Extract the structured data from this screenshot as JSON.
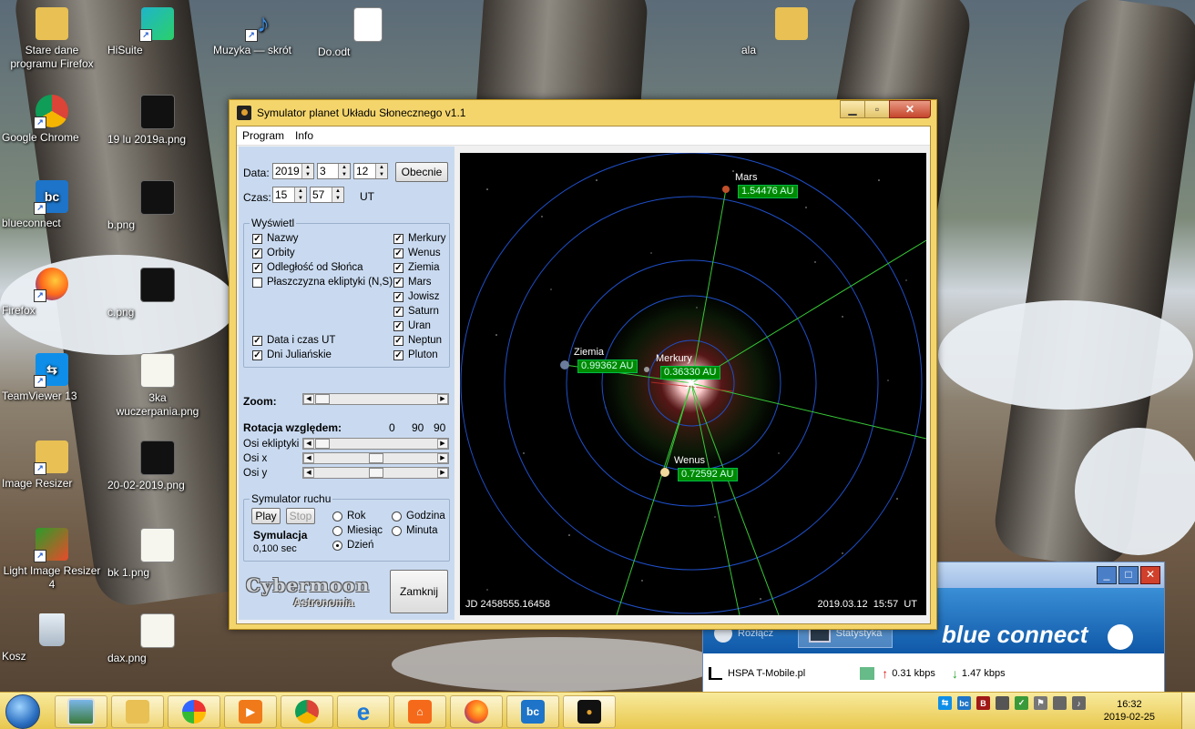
{
  "desktop": {
    "icons": [
      {
        "label": "Stare dane programu Firefox"
      },
      {
        "label": "HiSuite"
      },
      {
        "label": "Muzyka — skrót"
      },
      {
        "label": "Do.odt"
      },
      {
        "label": "ala"
      },
      {
        "label": "Google Chrome"
      },
      {
        "label": "19 lu 2019a.png"
      },
      {
        "label": "blueconnect"
      },
      {
        "label": "b.png"
      },
      {
        "label": "Firefox"
      },
      {
        "label": "c.png"
      },
      {
        "label": "TeamViewer 13"
      },
      {
        "label": "3ka wuczerpania.png"
      },
      {
        "label": "Image Resizer"
      },
      {
        "label": "20-02-2019.png"
      },
      {
        "label": "Light Image Resizer 4"
      },
      {
        "label": "bk 1.png"
      },
      {
        "label": "Kosz"
      },
      {
        "label": "dax.png"
      }
    ]
  },
  "window": {
    "title": "Symulator planet Układu Słonecznego v1.1",
    "menu": [
      "Program",
      "Info"
    ],
    "date_label": "Data:",
    "date": {
      "year": "2019",
      "month": "3",
      "day": "12"
    },
    "now_button": "Obecnie",
    "time_label": "Czas:",
    "time": {
      "hour": "15",
      "minute": "57"
    },
    "time_unit": "UT",
    "display_group": "Wyświetl",
    "display_options": [
      {
        "label": "Nazwy",
        "checked": true
      },
      {
        "label": "Orbity",
        "checked": true
      },
      {
        "label": "Odległość od Słońca",
        "checked": true
      },
      {
        "label": "Płaszczyzna ekliptyki (N,S)",
        "checked": false
      },
      {
        "label": "Data i czas UT",
        "checked": true
      },
      {
        "label": "Dni Juliańskie",
        "checked": true
      }
    ],
    "planet_options": [
      {
        "label": "Merkury",
        "checked": true
      },
      {
        "label": "Wenus",
        "checked": true
      },
      {
        "label": "Ziemia",
        "checked": true
      },
      {
        "label": "Mars",
        "checked": true
      },
      {
        "label": "Jowisz",
        "checked": true
      },
      {
        "label": "Saturn",
        "checked": true
      },
      {
        "label": "Uran",
        "checked": true
      },
      {
        "label": "Neptun",
        "checked": true
      },
      {
        "label": "Pluton",
        "checked": true
      }
    ],
    "zoom_label": "Zoom:",
    "rotation_label": "Rotacja względem:",
    "rotation_values": [
      "0",
      "90",
      "90"
    ],
    "axes": [
      "Osi ekliptyki",
      "Osi x",
      "Osi y"
    ],
    "sim_group": "Symulator ruchu",
    "play": "Play",
    "stop": "Stop",
    "sim_label": "Symulacja",
    "sim_value": "0,100 sec",
    "steps": [
      {
        "label": "Rok",
        "selected": false
      },
      {
        "label": "Miesiąc",
        "selected": false
      },
      {
        "label": "Dzień",
        "selected": true
      },
      {
        "label": "Godzina",
        "selected": false
      },
      {
        "label": "Minuta",
        "selected": false
      }
    ],
    "logo_line1": "Cybermoon",
    "logo_line2": "Astronomia",
    "close_button": "Zamknij",
    "view": {
      "planets": [
        {
          "name": "Mars",
          "distance": "1.54476 AU"
        },
        {
          "name": "Ziemia",
          "distance": "0.99362 AU"
        },
        {
          "name": "Merkury",
          "distance": "0.36330 AU"
        },
        {
          "name": "Wenus",
          "distance": "0.72592 AU"
        }
      ],
      "jd": "JD 2458555.16458",
      "datetime": "2019.03.12  15:57  UT"
    }
  },
  "blueconnect": {
    "disconnect": "Rozłącz",
    "stats": "Statystyka",
    "brand": "blue connect",
    "network": "HSPA T-Mobile.pl",
    "upload": "0.31 kbps",
    "download": "1.47 kbps"
  },
  "taskbar": {
    "time": "16:32",
    "date": "2019-02-25"
  }
}
